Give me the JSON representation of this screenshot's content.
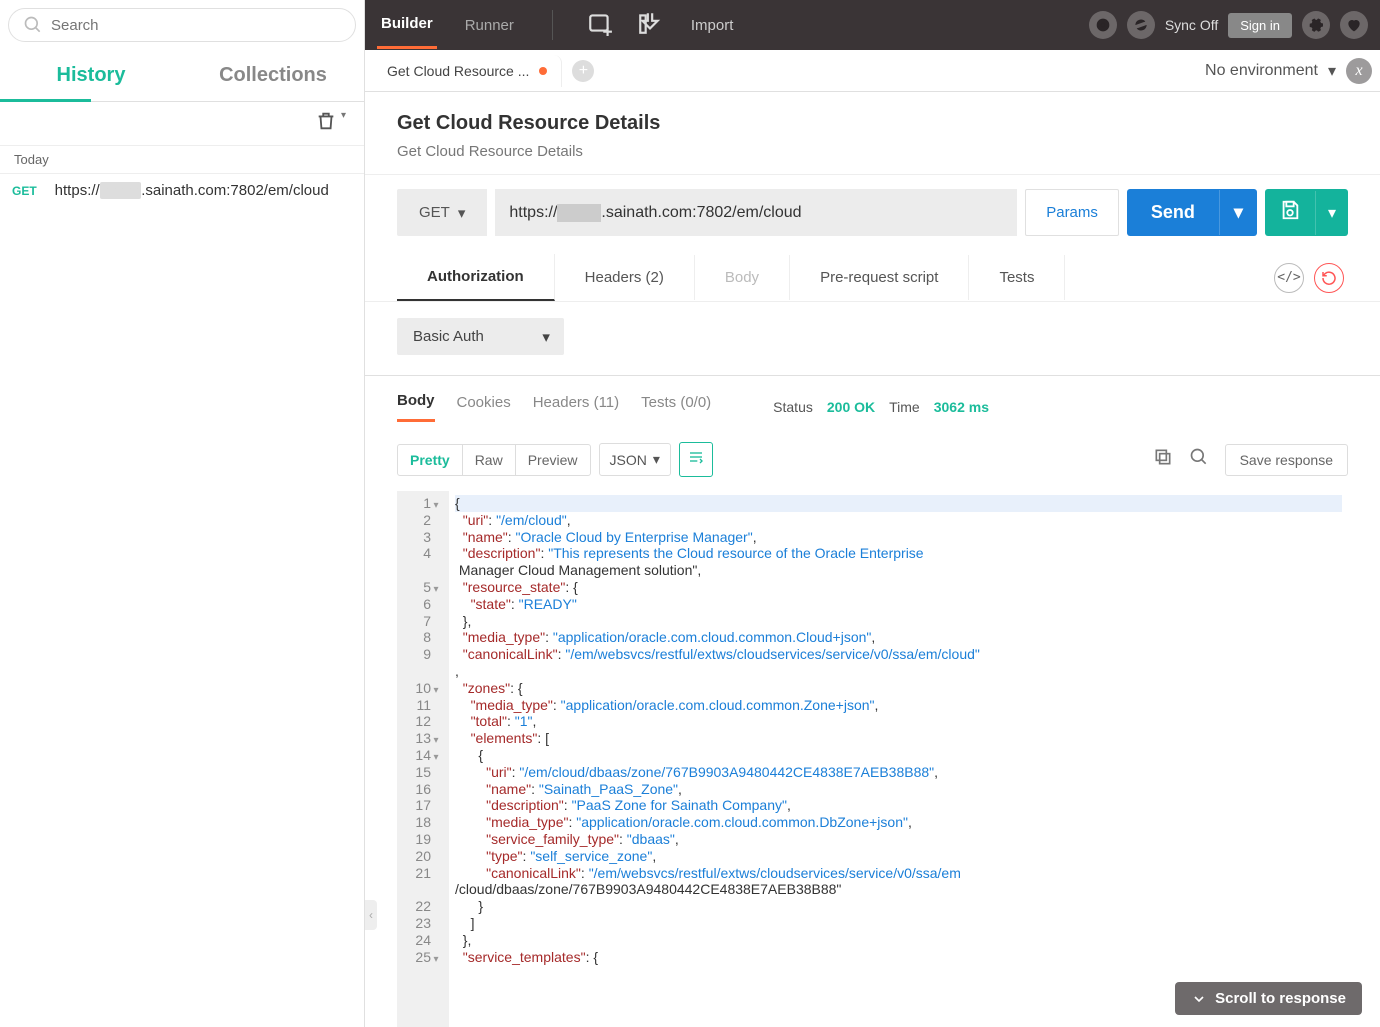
{
  "sidebar": {
    "search_placeholder": "Search",
    "tabs": {
      "history": "History",
      "collections": "Collections"
    },
    "today_label": "Today",
    "history": [
      {
        "method": "GET",
        "url_pre": "https://",
        "url_blur": "xxxxx",
        "url_post": ".sainath.com:7802/em/cloud"
      }
    ]
  },
  "topbar": {
    "builder": "Builder",
    "runner": "Runner",
    "import": "Import",
    "sync": "Sync Off",
    "signin": "Sign in"
  },
  "tabs": {
    "open_label": "Get Cloud Resource ...",
    "no_env": "No environment"
  },
  "request": {
    "title": "Get Cloud Resource Details",
    "subtitle": "Get Cloud Resource Details",
    "method": "GET",
    "url_pre": "https://",
    "url_blur": "xxxxx",
    "url_post": ".sainath.com:7802/em/cloud",
    "params": "Params",
    "send": "Send",
    "subtabs": {
      "auth": "Authorization",
      "headers": "Headers (2)",
      "body": "Body",
      "prereq": "Pre-request script",
      "tests": "Tests"
    },
    "auth_type": "Basic Auth"
  },
  "response": {
    "tabs": {
      "body": "Body",
      "cookies": "Cookies",
      "headers": "Headers (11)",
      "tests": "Tests (0/0)"
    },
    "status_lbl": "Status",
    "status_val": "200 OK",
    "time_lbl": "Time",
    "time_val": "3062 ms",
    "views": {
      "pretty": "Pretty",
      "raw": "Raw",
      "preview": "Preview"
    },
    "format": "JSON",
    "save": "Save response",
    "scroll": "Scroll to response",
    "json": {
      "uri": "/em/cloud",
      "name": "Oracle Cloud by Enterprise Manager",
      "description": "This represents the Cloud resource of the Oracle Enterprise Manager Cloud Management solution",
      "resource_state": {
        "state": "READY"
      },
      "media_type": "application/oracle.com.cloud.common.Cloud+json",
      "canonicalLink": "/em/websvcs/restful/extws/cloudservices/service/v0/ssa/em/cloud",
      "zones": {
        "media_type": "application/oracle.com.cloud.common.Zone+json",
        "total": "1",
        "elements": [
          {
            "uri": "/em/cloud/dbaas/zone/767B9903A9480442CE4838E7AEB38B88",
            "name": "Sainath_PaaS_Zone",
            "description": "PaaS Zone for Sainath Company",
            "media_type": "application/oracle.com.cloud.common.DbZone+json",
            "service_family_type": "dbaas",
            "type": "self_service_zone",
            "canonicalLink": "/em/websvcs/restful/extws/cloudservices/service/v0/ssa/em/cloud/dbaas/zone/767B9903A9480442CE4838E7AEB38B88"
          }
        ]
      },
      "service_templates_key": "service_templates"
    }
  }
}
